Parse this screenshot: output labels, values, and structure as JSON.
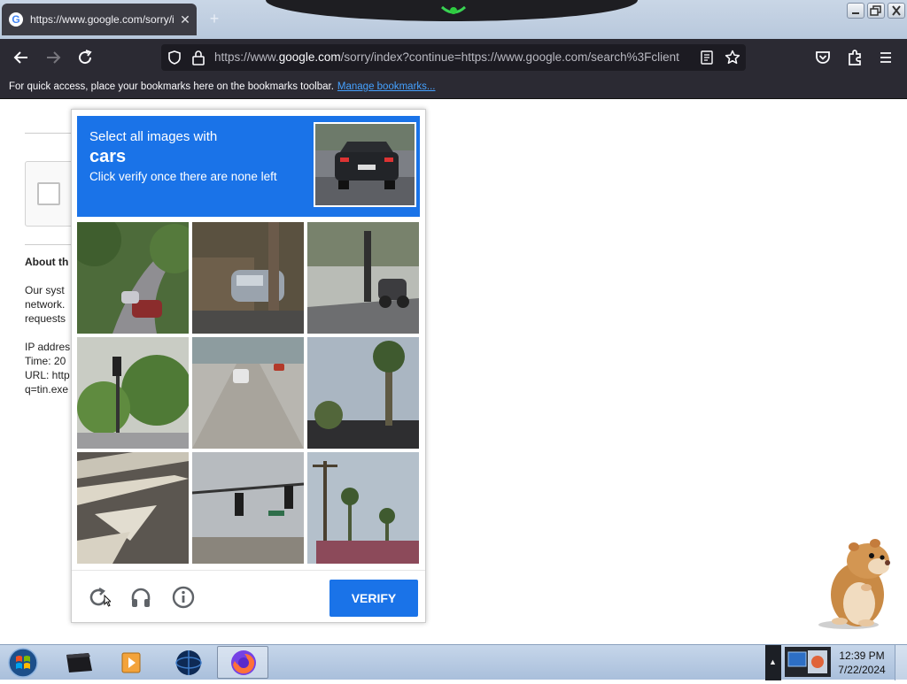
{
  "browser": {
    "tab": {
      "title": "https://www.google.com/sorry/index?",
      "close_glyph": "✕",
      "favicon_letter": "G"
    },
    "new_tab_glyph": "+",
    "url": {
      "prefix": "https://www.",
      "host": "google.com",
      "rest": "/sorry/index?continue=https://www.google.com/search%3Fclient"
    },
    "bookmarks_bar": {
      "message": "For quick access, place your bookmarks here on the bookmarks toolbar.",
      "link": "Manage bookmarks..."
    }
  },
  "page": {
    "about_heading": "About th",
    "para_lines": [
      "Our syst",
      "network.",
      "requests"
    ],
    "info_lines": [
      "IP addres",
      "Time: 20",
      "URL: http",
      "q=tin.exe"
    ]
  },
  "captcha": {
    "instruction": "Select all images with",
    "target": "cars",
    "subinstruction": "Click verify once there are none left",
    "verify_label": "VERIFY",
    "footer_icons": [
      "reload-icon",
      "audio-challenge-icon",
      "info-icon"
    ]
  },
  "taskbar": {
    "time": "12:39 PM",
    "date": "7/22/2024",
    "tray_arrow": "▲"
  },
  "colors": {
    "captcha_blue": "#1a73e8",
    "firefox_toolbar": "#2b2a33",
    "link_blue": "#45a1ff"
  }
}
